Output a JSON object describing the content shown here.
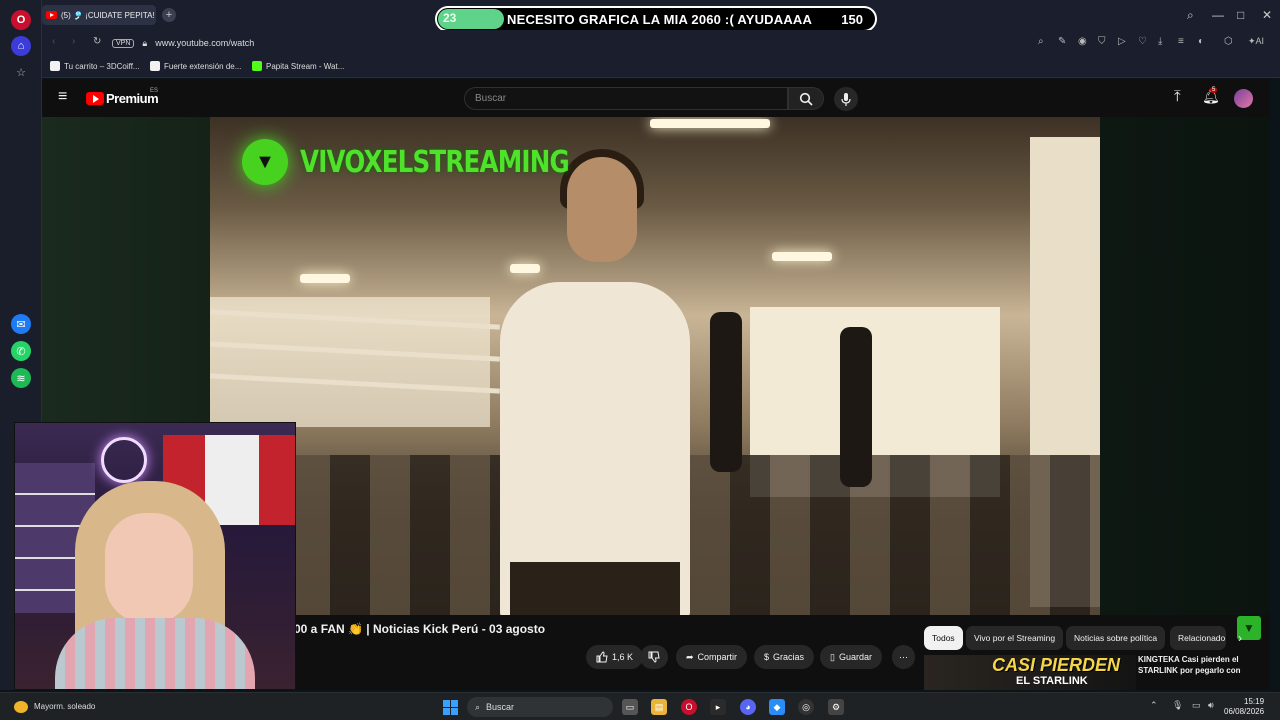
{
  "browser": {
    "tab_title": "(5) 🎐 ¡CUIDATE PEPITA!",
    "url": "www.youtube.com/watch",
    "vpn_label": "VPN",
    "ai_label": "AI",
    "bookmarks": [
      {
        "label": "Tu carrito – 3DCoiff..."
      },
      {
        "label": "Fuerte extensión de..."
      },
      {
        "label": "Papita Stream - Wat..."
      }
    ],
    "toolbar_icons": [
      "search-icon",
      "snapshot-icon",
      "camera-icon",
      "shield-icon",
      "play-icon",
      "heart-icon",
      "download-icon",
      "menu-icon",
      "profile-icon",
      "extension-icon"
    ]
  },
  "stream_overlay": {
    "count": "23",
    "goal": "150",
    "progress": 0.15,
    "message": "NECESITO GRAFICA LA MIA 2060 :( AYUDAAAA"
  },
  "youtube": {
    "logo_text": "Premium",
    "region": "ES",
    "search_placeholder": "Buscar",
    "notification_count": "5",
    "channel_overlay": "VIVOXELSTREAMING",
    "video_title": "00 a FAN 👏 | Noticias Kick Perú - 03 agosto",
    "actions": {
      "likes": "1,6 K",
      "share": "Compartir",
      "thanks": "Gracias",
      "save": "Guardar"
    },
    "chips": [
      "Todos",
      "Vivo por el Streaming",
      "Noticias sobre política",
      "Relacionado"
    ],
    "recommendation": {
      "thumb_text": "CASI PIERDEN",
      "thumb_sub": "EL STARLINK",
      "title": "KINGTEKA Casi pierden el STARLINK por pegarlo con"
    }
  },
  "taskbar": {
    "weather": "Mayorm. soleado",
    "search": "Buscar",
    "time": "15:19",
    "date": "06/08/2026"
  },
  "colors": {
    "overlay_progress": "#5fd38a",
    "channel_green": "#4ee22a",
    "youtube_red": "#ff0000"
  }
}
